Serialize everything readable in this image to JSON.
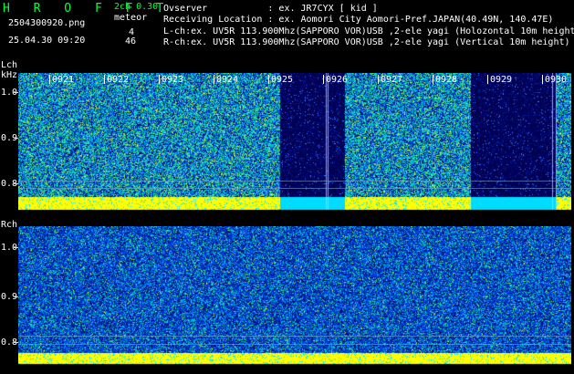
{
  "header": {
    "logo": "H R O F F T",
    "mode": "2ch 0.30",
    "meteor_label": "meteor",
    "filename": "2504300920.png",
    "datetime": "25.04.30 09:20",
    "lch_count": "4",
    "rch_count": "46",
    "observer_line": "Ovserver           : ex. JR7CYX [ kid ]",
    "location_line": "Receiving Location : ex. Aomori City Aomori-Pref.JAPAN(40.49N, 140.47E)",
    "lch_line": "L-ch:ex. UV5R 113.900Mhz(SAPPORO VOR)USB ,2-ele yagi (Holozontal 10m height)",
    "rch_line": "R-ch:ex. UV5R 113.900Mhz(SAPPORO VOR)USB ,2-ele yagi (Vertical 10m height)"
  },
  "lch": {
    "label": "Lch",
    "unit": "kHz",
    "y_ticks": [
      "1.0",
      "0.9",
      "0.8"
    ],
    "time_labels": [
      "0921",
      "0922",
      "0923",
      "0924",
      "0925",
      "0926",
      "0927",
      "0928",
      "0929",
      "0930"
    ]
  },
  "rch": {
    "label": "Rch",
    "y_ticks": [
      "1.0",
      "0.9",
      "0.8"
    ]
  },
  "colors": {
    "text_green": "#00ff3c",
    "text_white": "#ffffff",
    "signal_yellow": "#ffff00",
    "noise_cyan": "#00ffff",
    "dark_blue": "#000060",
    "mid_blue": "#0020ff"
  }
}
